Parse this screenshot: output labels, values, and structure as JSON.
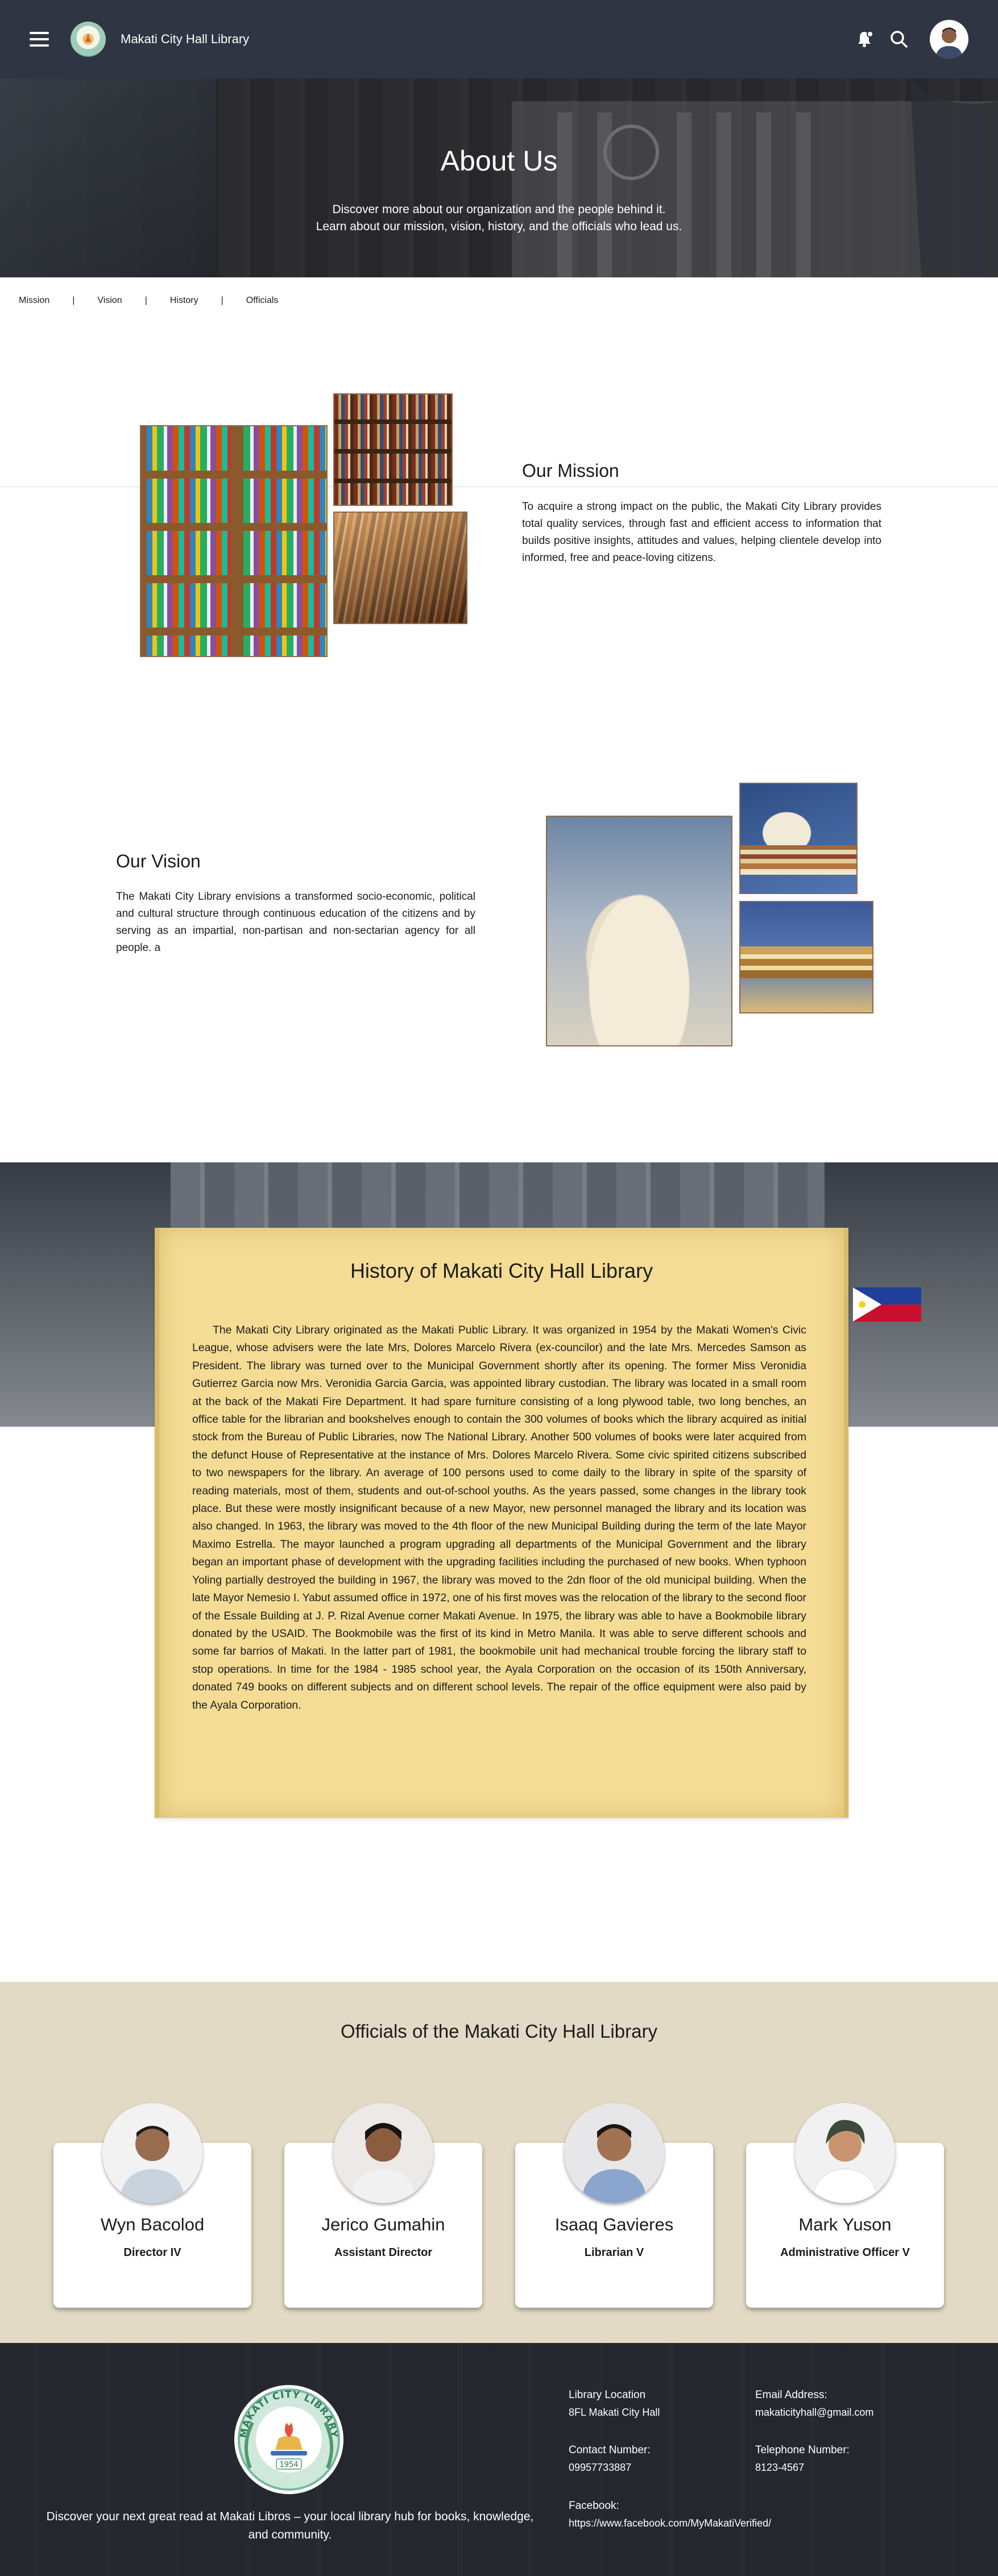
{
  "header": {
    "app_title": "Makati City Hall Library"
  },
  "hero": {
    "title": "About Us",
    "subtitle_line1": "Discover more about our organization and the people behind it.",
    "subtitle_line2": "Learn about our mission, vision, history, and the officials who lead us."
  },
  "subnav": {
    "items": [
      "Mission",
      "Vision",
      "History",
      "Officials"
    ],
    "separator": "|"
  },
  "mission": {
    "title": "Our Mission",
    "body": "To acquire a strong impact on the public, the Makati City Library provides total quality services, through fast and efficient access to information that builds positive insights, attitudes and values, helping clientele develop into informed, free and peace-loving citizens."
  },
  "vision": {
    "title": "Our Vision",
    "body": "The Makati City Library envisions a transformed socio-economic, political and cultural structure through continuous education of the citizens and by serving as an impartial, non-partisan and non-sectarian agency for all people. a"
  },
  "history": {
    "title": "History of Makati City Hall Library",
    "body": "The Makati City Library originated as the Makati Public Library. It was organized in 1954 by the Makati Women's Civic League, whose advisers were the late Mrs, Dolores Marcelo Rivera (ex-councilor) and the late Mrs. Mercedes Samson as President. The library was turned over to the Municipal Government shortly after its opening. The former Miss Veronidia Gutierrez Garcia now Mrs. Veronidia Garcia Garcia, was appointed library custodian. The library was located in a small room at the back of the Makati Fire Department. It had spare furniture consisting of a long plywood table, two long benches, an office table for the librarian and bookshelves enough to contain the 300 volumes of books which the library acquired as initial stock from the Bureau of Public Libraries, now The National Library. Another 500 volumes of books were later acquired from the defunct House of Representative at the instance of Mrs. Dolores Marcelo Rivera. Some civic spirited citizens subscribed to two newspapers for the library. An average of 100 persons used to come daily to the library in spite of the sparsity of reading materials, most of them, students and out-of-school youths. As the years passed, some changes in the library took place. But these were mostly insignificant because of a new Mayor, new personnel managed the library and its location was also changed. In 1963, the library was moved to the 4th floor of the new Municipal Building during the term of the late Mayor Maximo Estrella. The mayor launched a program upgrading all departments of the Municipal Government and the library began an important phase of development with the upgrading facilities including the purchased of new books. When typhoon Yoling partially destroyed the building in 1967, the library was moved to the 2dn floor of the old municipal building. When the late Mayor Nemesio I. Yabut assumed office in 1972, one of his first moves was the relocation of the library to the second floor of the Essale Building at J. P. Rizal Avenue corner Makati Avenue. In 1975, the library was able to have a Bookmobile library donated by the USAID. The Bookmobile was the first of its kind in Metro Manila. It was able to serve different schools and some far barrios of Makati. In the latter part of 1981, the bookmobile unit had mechanical trouble forcing the library staff to stop operations. In time for the 1984 - 1985 school year, the Ayala Corporation on the occasion of its 150th Anniversary, donated 749 books on different subjects and on different school levels. The repair of the office equipment were also paid by the Ayala Corporation."
  },
  "officials": {
    "title": "Officials of the Makati City Hall Library",
    "people": [
      {
        "name": "Wyn Bacolod",
        "role": "Director IV"
      },
      {
        "name": "Jerico Gumahin",
        "role": "Assistant Director"
      },
      {
        "name": "Isaaq Gavieres",
        "role": "Librarian V"
      },
      {
        "name": "Mark Yuson",
        "role": "Administrative Officer V"
      }
    ]
  },
  "footer": {
    "logo_text": "MAKATI CITY LIBRARY",
    "logo_year": "1954",
    "tagline": "Discover your next great read at Makati Libros – your local library hub for books, knowledge, and community.",
    "location_label": "Library Location",
    "location_value": "8FL Makati City Hall",
    "email_label": "Email Address:",
    "email_value": "makaticityhall@gmail.com",
    "contact_label": "Contact Number:",
    "contact_value": "09957733887",
    "telephone_label": "Telephone Number:",
    "telephone_value": "8123-4567",
    "facebook_label": "Facebook:",
    "facebook_value": "https://www.facebook.com/MyMakatiVerified/"
  },
  "icons": {
    "menu": "hamburger-menu-icon",
    "notifications": "bell-icon",
    "search": "search-icon",
    "profile": "user-avatar"
  },
  "colors": {
    "header_bg": "#2f3542",
    "parchment": "#f4dc94",
    "officials_band": "#e2dac4",
    "footer_bg": "#2a2e36"
  }
}
